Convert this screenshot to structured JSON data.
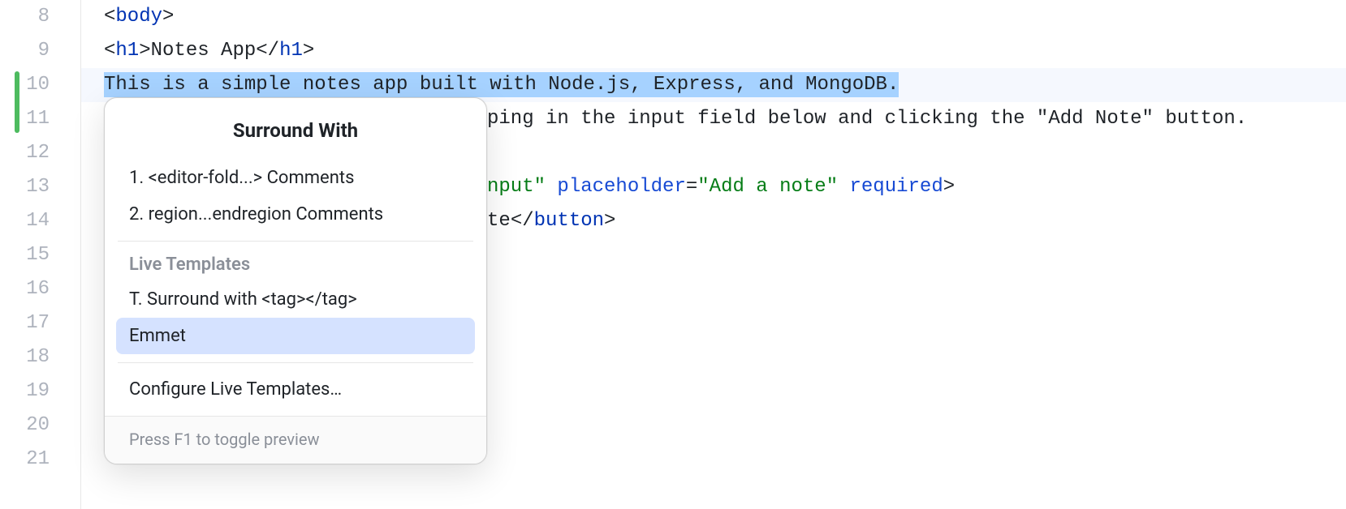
{
  "gutter": {
    "lines": [
      8,
      9,
      10,
      11,
      12,
      13,
      14,
      15,
      16,
      17,
      18,
      19,
      20,
      21
    ],
    "change_bar": {
      "from_index": 2,
      "to_index": 3
    }
  },
  "code": {
    "line8": {
      "seg": [
        {
          "t": "<",
          "c": "tok-punc"
        },
        {
          "t": "body",
          "c": "tok-tag"
        },
        {
          "t": ">",
          "c": "tok-punc"
        }
      ]
    },
    "line9": {
      "seg": [
        {
          "t": "<",
          "c": "tok-punc"
        },
        {
          "t": "h1",
          "c": "tok-tag"
        },
        {
          "t": ">",
          "c": "tok-punc"
        },
        {
          "t": "Notes App",
          "c": "tok-plain"
        },
        {
          "t": "</",
          "c": "tok-punc"
        },
        {
          "t": "h1",
          "c": "tok-tag"
        },
        {
          "t": ">",
          "c": "tok-punc"
        }
      ]
    },
    "line10_selected": "This is a simple notes app built with Node.js, Express, and MongoDB.",
    "line11_visible": "ping in the input field below and clicking the \"Add Note\" button.",
    "line13": {
      "seg": [
        {
          "t": "nput\"",
          "c": "tok-val"
        },
        {
          "t": " ",
          "c": "tok-plain"
        },
        {
          "t": "placeholder",
          "c": "tok-attr"
        },
        {
          "t": "=",
          "c": "tok-punc"
        },
        {
          "t": "\"Add a note\"",
          "c": "tok-val"
        },
        {
          "t": " ",
          "c": "tok-plain"
        },
        {
          "t": "required",
          "c": "tok-attr"
        },
        {
          "t": ">",
          "c": "tok-punc"
        }
      ]
    },
    "line14": {
      "seg": [
        {
          "t": "te",
          "c": "tok-plain"
        },
        {
          "t": "</",
          "c": "tok-punc"
        },
        {
          "t": "button",
          "c": "tok-tag"
        },
        {
          "t": ">",
          "c": "tok-punc"
        }
      ]
    }
  },
  "popup": {
    "title": "Surround With",
    "item1": "1. <editor-fold...> Comments",
    "item2": "2. region...endregion Comments",
    "heading": "Live Templates",
    "itemT": "T. Surround with <tag></tag>",
    "itemEmmet": "Emmet",
    "configure": "Configure Live Templates…",
    "footer": "Press F1 to toggle preview"
  }
}
